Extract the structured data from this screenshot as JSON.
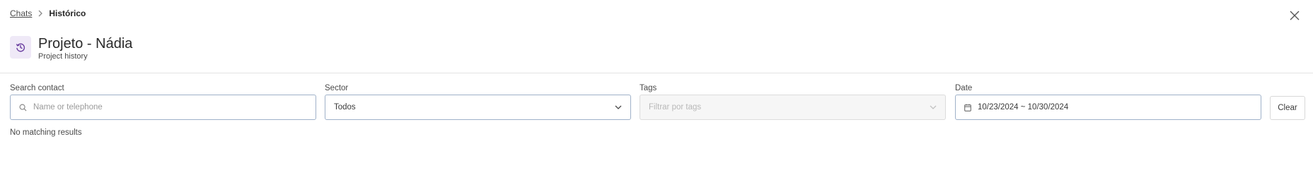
{
  "breadcrumb": {
    "parent": "Chats",
    "current": "Histórico"
  },
  "header": {
    "icon": "history-icon",
    "title": "Projeto - Nádia",
    "subtitle": "Project history",
    "icon_bg_color": "#efe9f7",
    "icon_color": "#6b3fa0"
  },
  "filters": {
    "search": {
      "label": "Search contact",
      "placeholder": "Name or telephone",
      "value": ""
    },
    "sector": {
      "label": "Sector",
      "value": "Todos"
    },
    "tags": {
      "label": "Tags",
      "placeholder": "Filtrar por tags",
      "disabled": true
    },
    "date": {
      "label": "Date",
      "value": "10/23/2024 ~ 10/30/2024"
    },
    "clear_label": "Clear"
  },
  "results": {
    "empty_message": "No matching results"
  }
}
